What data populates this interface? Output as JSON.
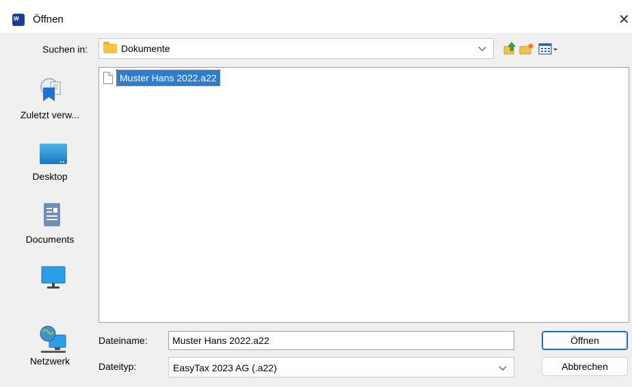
{
  "window": {
    "title": "Öffnen",
    "app_icon": "easytax-app-icon",
    "close_label": "✕"
  },
  "toolbar": {
    "lookin_label": "Suchen in:",
    "lookin_value": "Dokumente",
    "lookin_icon": "folder-icon",
    "icons": [
      "up-folder-icon",
      "new-folder-icon",
      "view-menu-icon"
    ]
  },
  "places": [
    {
      "label": "Zuletzt verw...",
      "icon": "recent-icon"
    },
    {
      "label": "Desktop",
      "icon": "desktop-icon"
    },
    {
      "label": "Documents",
      "icon": "documents-icon"
    },
    {
      "label": "",
      "icon": "this-pc-icon"
    },
    {
      "label": "Netzwerk",
      "icon": "network-icon"
    }
  ],
  "files": [
    {
      "name": "Muster Hans 2022.a22",
      "selected": true,
      "icon": "file-icon"
    }
  ],
  "filename": {
    "label": "Dateiname:",
    "value": "Muster Hans 2022.a22"
  },
  "filetype": {
    "label": "Dateityp:",
    "value": "EasyTax 2023 AG (.a22)"
  },
  "buttons": {
    "open": "Öffnen",
    "cancel": "Abbrechen"
  },
  "colors": {
    "selection": "#2a7dd2",
    "default_button_border": "#1e66b8"
  }
}
